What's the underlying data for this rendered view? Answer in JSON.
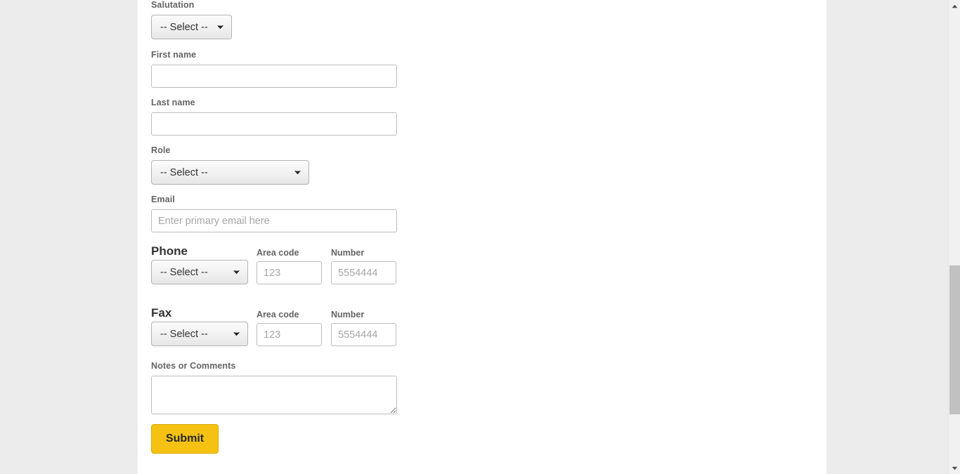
{
  "colors": {
    "page_background": "#ececec",
    "content_background": "#ffffff",
    "label_text": "#646464",
    "heading_text": "#333333",
    "input_border": "#bdbdbd",
    "select_border": "#b3b3b3",
    "placeholder_text": "#a6a6a6",
    "submit_background": "#f5c213",
    "submit_border": "#d9a800",
    "submit_text": "#262626",
    "scrollbar_track": "#f1f1f1",
    "scrollbar_thumb": "#c1c1c1"
  },
  "form": {
    "salutation": {
      "label": "Salutation",
      "select_value": "-- Select --",
      "chevron_icon": "chevron-down-icon"
    },
    "first_name": {
      "label": "First name",
      "value": "",
      "placeholder": ""
    },
    "last_name": {
      "label": "Last name",
      "value": "",
      "placeholder": ""
    },
    "role": {
      "label": "Role",
      "select_value": "-- Select --",
      "chevron_icon": "chevron-down-icon"
    },
    "email": {
      "label": "Email",
      "value": "",
      "placeholder": "Enter primary email here"
    },
    "phone": {
      "heading": "Phone",
      "select_value": "-- Select --",
      "chevron_icon": "chevron-down-icon",
      "area_code_label": "Area code",
      "area_code_value": "",
      "area_code_placeholder": "123",
      "number_label": "Number",
      "number_value": "",
      "number_placeholder": "5554444"
    },
    "fax": {
      "heading": "Fax",
      "select_value": "-- Select --",
      "chevron_icon": "chevron-down-icon",
      "area_code_label": "Area code",
      "area_code_value": "",
      "area_code_placeholder": "123",
      "number_label": "Number",
      "number_value": "",
      "number_placeholder": "5554444"
    },
    "notes": {
      "label": "Notes or Comments",
      "value": "",
      "placeholder": ""
    },
    "submit": {
      "label": "Submit"
    }
  },
  "scrollbar": {
    "up_arrow_icon": "triangle-up-icon",
    "down_arrow_icon": "triangle-down-icon"
  }
}
